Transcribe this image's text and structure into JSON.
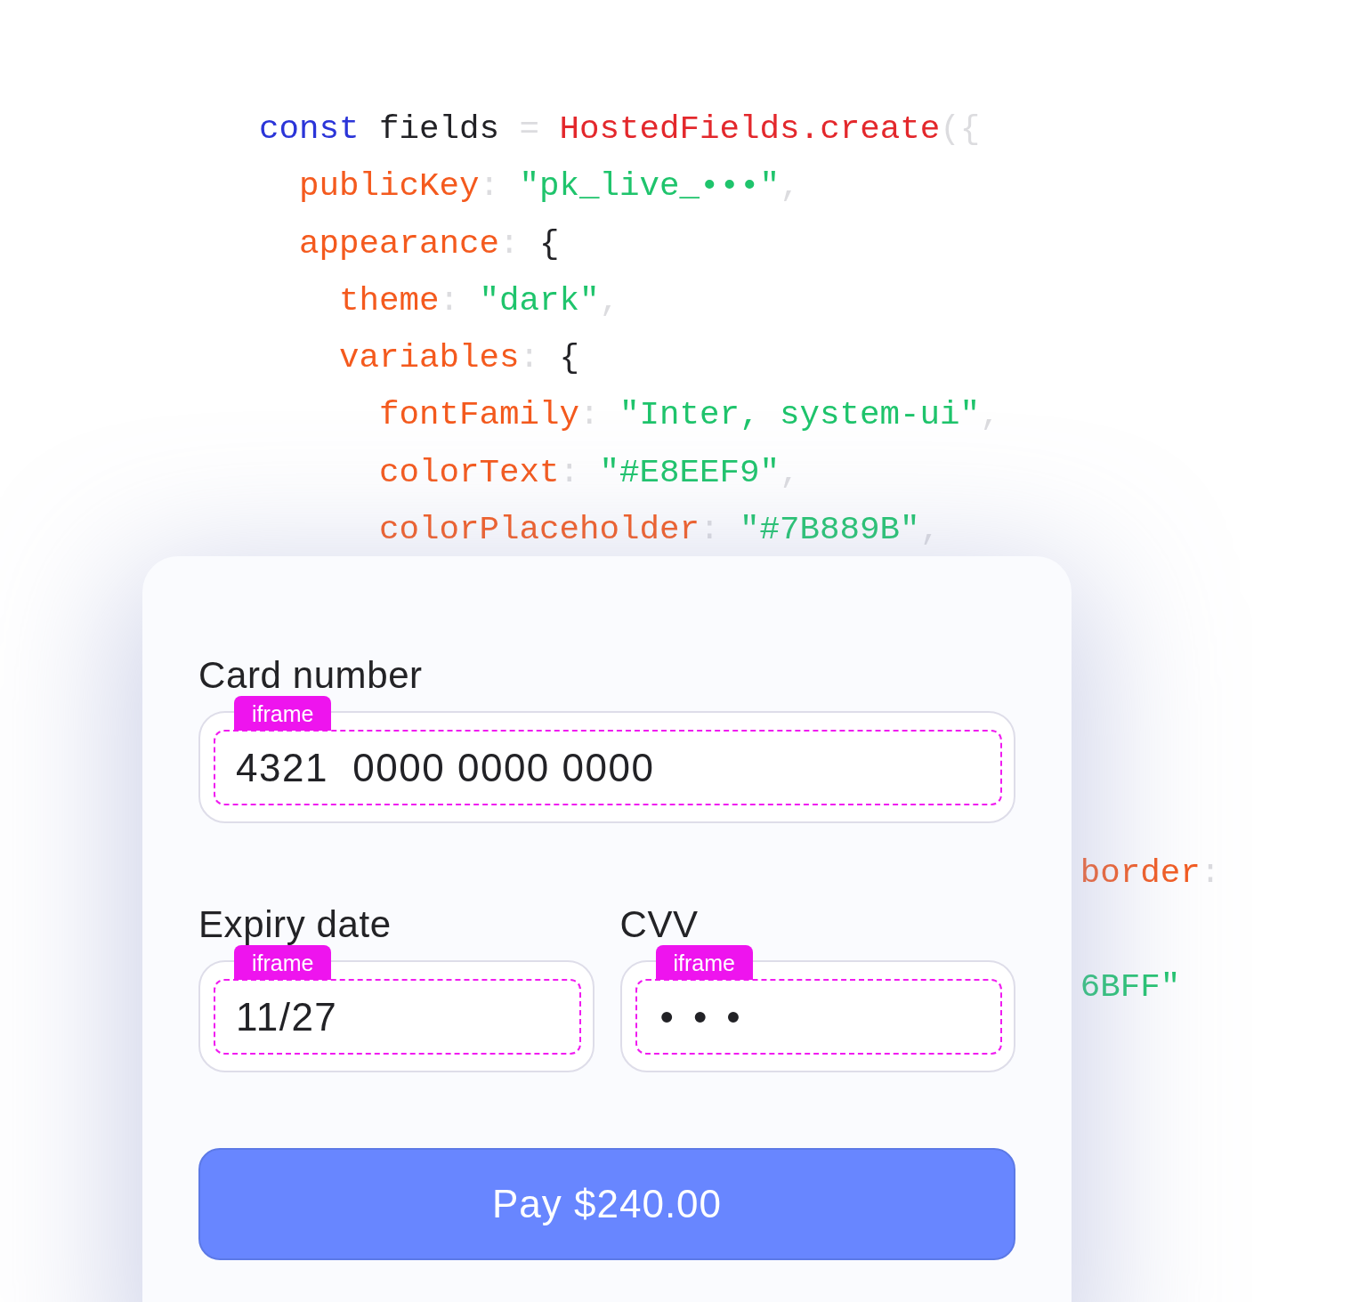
{
  "code": {
    "lines": [
      {
        "tokens": [
          {
            "kind": "keyword",
            "text": "const "
          },
          {
            "kind": "name",
            "text": "fields "
          },
          {
            "kind": "punct",
            "text": "= "
          },
          {
            "kind": "function",
            "text": "HostedFields.create"
          },
          {
            "kind": "punct",
            "text": "({"
          }
        ],
        "children": [
          {
            "tokens": [
              {
                "kind": "property",
                "text": "publicKey"
              },
              {
                "kind": "punct",
                "text": ": "
              },
              {
                "kind": "string",
                "text": "\"pk_live_•••\""
              },
              {
                "kind": "punct",
                "text": ","
              }
            ]
          },
          {
            "tokens": [
              {
                "kind": "property",
                "text": "appearance"
              },
              {
                "kind": "punct",
                "text": ": "
              },
              {
                "kind": "brace",
                "text": "{"
              }
            ],
            "children": [
              {
                "tokens": [
                  {
                    "kind": "property",
                    "text": "theme"
                  },
                  {
                    "kind": "punct",
                    "text": ": "
                  },
                  {
                    "kind": "string",
                    "text": "\"dark\""
                  },
                  {
                    "kind": "punct",
                    "text": ","
                  }
                ]
              },
              {
                "tokens": [
                  {
                    "kind": "property",
                    "text": "variables"
                  },
                  {
                    "kind": "punct",
                    "text": ": "
                  },
                  {
                    "kind": "brace",
                    "text": "{"
                  }
                ],
                "children": [
                  {
                    "tokens": [
                      {
                        "kind": "property",
                        "text": "fontFamily"
                      },
                      {
                        "kind": "punct",
                        "text": ": "
                      },
                      {
                        "kind": "string",
                        "text": "\"Inter, system-ui\""
                      },
                      {
                        "kind": "punct",
                        "text": ","
                      }
                    ]
                  },
                  {
                    "tokens": [
                      {
                        "kind": "property",
                        "text": "colorText"
                      },
                      {
                        "kind": "punct",
                        "text": ": "
                      },
                      {
                        "kind": "string",
                        "text": "\"#E8EEF9\""
                      },
                      {
                        "kind": "punct",
                        "text": ","
                      }
                    ]
                  },
                  {
                    "tokens": [
                      {
                        "kind": "property",
                        "text": "colorPlaceholder"
                      },
                      {
                        "kind": "punct",
                        "text": ": "
                      },
                      {
                        "kind": "string",
                        "text": "\"#7B889B\""
                      },
                      {
                        "kind": "punct",
                        "text": ","
                      }
                    ]
                  }
                ]
              }
            ]
          }
        ]
      }
    ],
    "peek_lines": [
      {
        "tokens": [
          {
            "kind": "property",
            "text": "border"
          },
          {
            "kind": "punct",
            "text": ":"
          }
        ]
      },
      {
        "tokens": [
          {
            "kind": "string",
            "text": "6BFF\""
          }
        ]
      }
    ]
  },
  "form": {
    "fields": [
      {
        "label": "Card number",
        "tag": "iframe",
        "kind": "text",
        "value": "4321  0000 0000 0000"
      },
      {
        "label": "Expiry date",
        "tag": "iframe",
        "kind": "text",
        "value": "11/27"
      },
      {
        "label": "CVV",
        "tag": "iframe",
        "kind": "masked",
        "value": "•••"
      }
    ],
    "pay_button": {
      "label": "Pay $240.00"
    }
  }
}
